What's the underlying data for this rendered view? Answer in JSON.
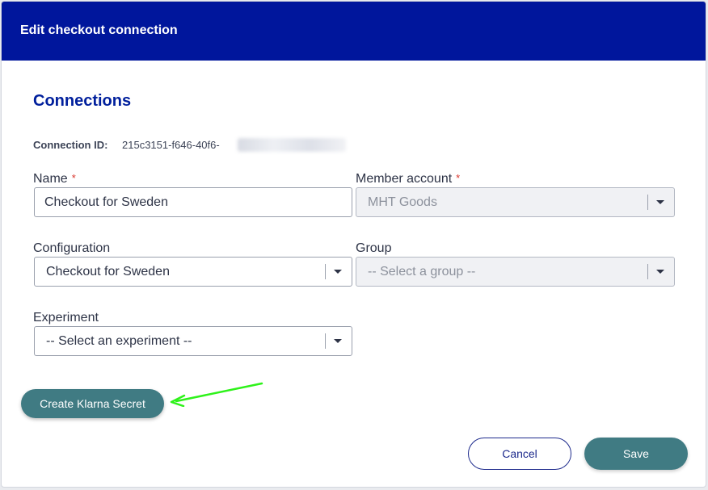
{
  "dialog": {
    "title": "Edit checkout connection",
    "section_title": "Connections"
  },
  "connection": {
    "id_label": "Connection ID:",
    "id_value": "215c3151-f646-40f6-"
  },
  "form": {
    "name": {
      "label": "Name",
      "required_mark": "*",
      "value": "Checkout for Sweden"
    },
    "member_account": {
      "label": "Member account",
      "required_mark": "*",
      "value": "MHT Goods",
      "disabled": true
    },
    "configuration": {
      "label": "Configuration",
      "value": "Checkout for Sweden"
    },
    "group": {
      "label": "Group",
      "value": "-- Select a group --",
      "disabled": true
    },
    "experiment": {
      "label": "Experiment",
      "value": "-- Select an experiment --"
    }
  },
  "buttons": {
    "create_klarna_secret": "Create Klarna Secret",
    "cancel": "Cancel",
    "save": "Save"
  },
  "colors": {
    "header_bg": "#00169c",
    "accent_teal": "#407b83",
    "required_red": "#d9342b",
    "annotation_arrow": "#2ef21a"
  },
  "icons": {
    "dropdown": "caret-down-icon",
    "annotation": "arrow-annotation-icon"
  }
}
